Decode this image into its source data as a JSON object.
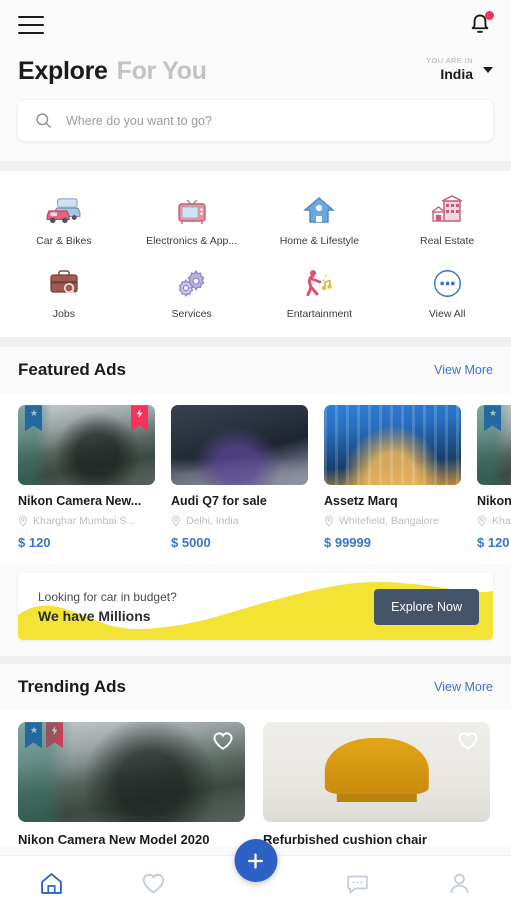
{
  "header": {
    "menu_icon": "hamburger-menu-icon",
    "notification_icon": "bell-icon",
    "notification_badge": "",
    "tab_active": "Explore",
    "tab_inactive": "For You",
    "location_kicker": "YOU ARE IN",
    "location_value": "India",
    "location_caret": "chevron-down-icon"
  },
  "search": {
    "icon": "search-icon",
    "placeholder": "Where do you want to go?",
    "value": ""
  },
  "categories": [
    {
      "label": "Car & Bikes",
      "icon": "car-icon"
    },
    {
      "label": "Electronics & App...",
      "icon": "television-icon"
    },
    {
      "label": "Home & Lifestyle",
      "icon": "house-icon"
    },
    {
      "label": "Real Estate",
      "icon": "building-icon"
    },
    {
      "label": "Jobs",
      "icon": "briefcase-icon"
    },
    {
      "label": "Services",
      "icon": "gears-icon"
    },
    {
      "label": "Entartainment",
      "icon": "dancer-music-icon"
    },
    {
      "label": "View All",
      "icon": "ellipsis-circle-icon"
    }
  ],
  "featured": {
    "title": "Featured Ads",
    "view_more": "View More",
    "cards": [
      {
        "title": "Nikon Camera New...",
        "location": "Kharghar Mumbai S...",
        "price": "$ 120",
        "badges": [
          "star",
          "bolt"
        ],
        "img": "ph-street"
      },
      {
        "title": "Audi Q7 for sale",
        "location": "Delhi, India",
        "price": "$ 5000",
        "badges": [],
        "img": "ph-car"
      },
      {
        "title": "Assetz Marq",
        "location": "Whitefield, Bangalore",
        "price": "$ 99999",
        "badges": [],
        "img": "ph-bldg"
      },
      {
        "title": "Nikon Camera New...",
        "location": "Kharghar Mumbai S...",
        "price": "$ 120",
        "badges": [
          "star"
        ],
        "img": "ph-street"
      }
    ]
  },
  "promo": {
    "line1": "Looking for car in budget?",
    "line2": "We have Millions",
    "button": "Explore Now",
    "wave_color": "#f2e335",
    "button_color": "#44556b"
  },
  "trending": {
    "title": "Trending Ads",
    "view_more": "View More",
    "cards": [
      {
        "title": "Nikon Camera New Model 2020",
        "badges": [
          "star",
          "bolt"
        ],
        "favorite_icon": "heart-outline-icon",
        "img": "ph-street"
      },
      {
        "title": "Refurbished cushion chair",
        "badges": [],
        "favorite_icon": "heart-outline-icon",
        "img": "ph-chair"
      }
    ]
  },
  "bottom_nav": {
    "items": [
      {
        "icon": "home-icon",
        "active": true
      },
      {
        "icon": "heart-icon",
        "active": false
      },
      {
        "icon": "chat-icon",
        "active": false
      },
      {
        "icon": "profile-icon",
        "active": false
      }
    ],
    "fab_icon": "plus-icon",
    "active_color": "#2d62c4",
    "inactive_color": "#c4cdd6"
  }
}
